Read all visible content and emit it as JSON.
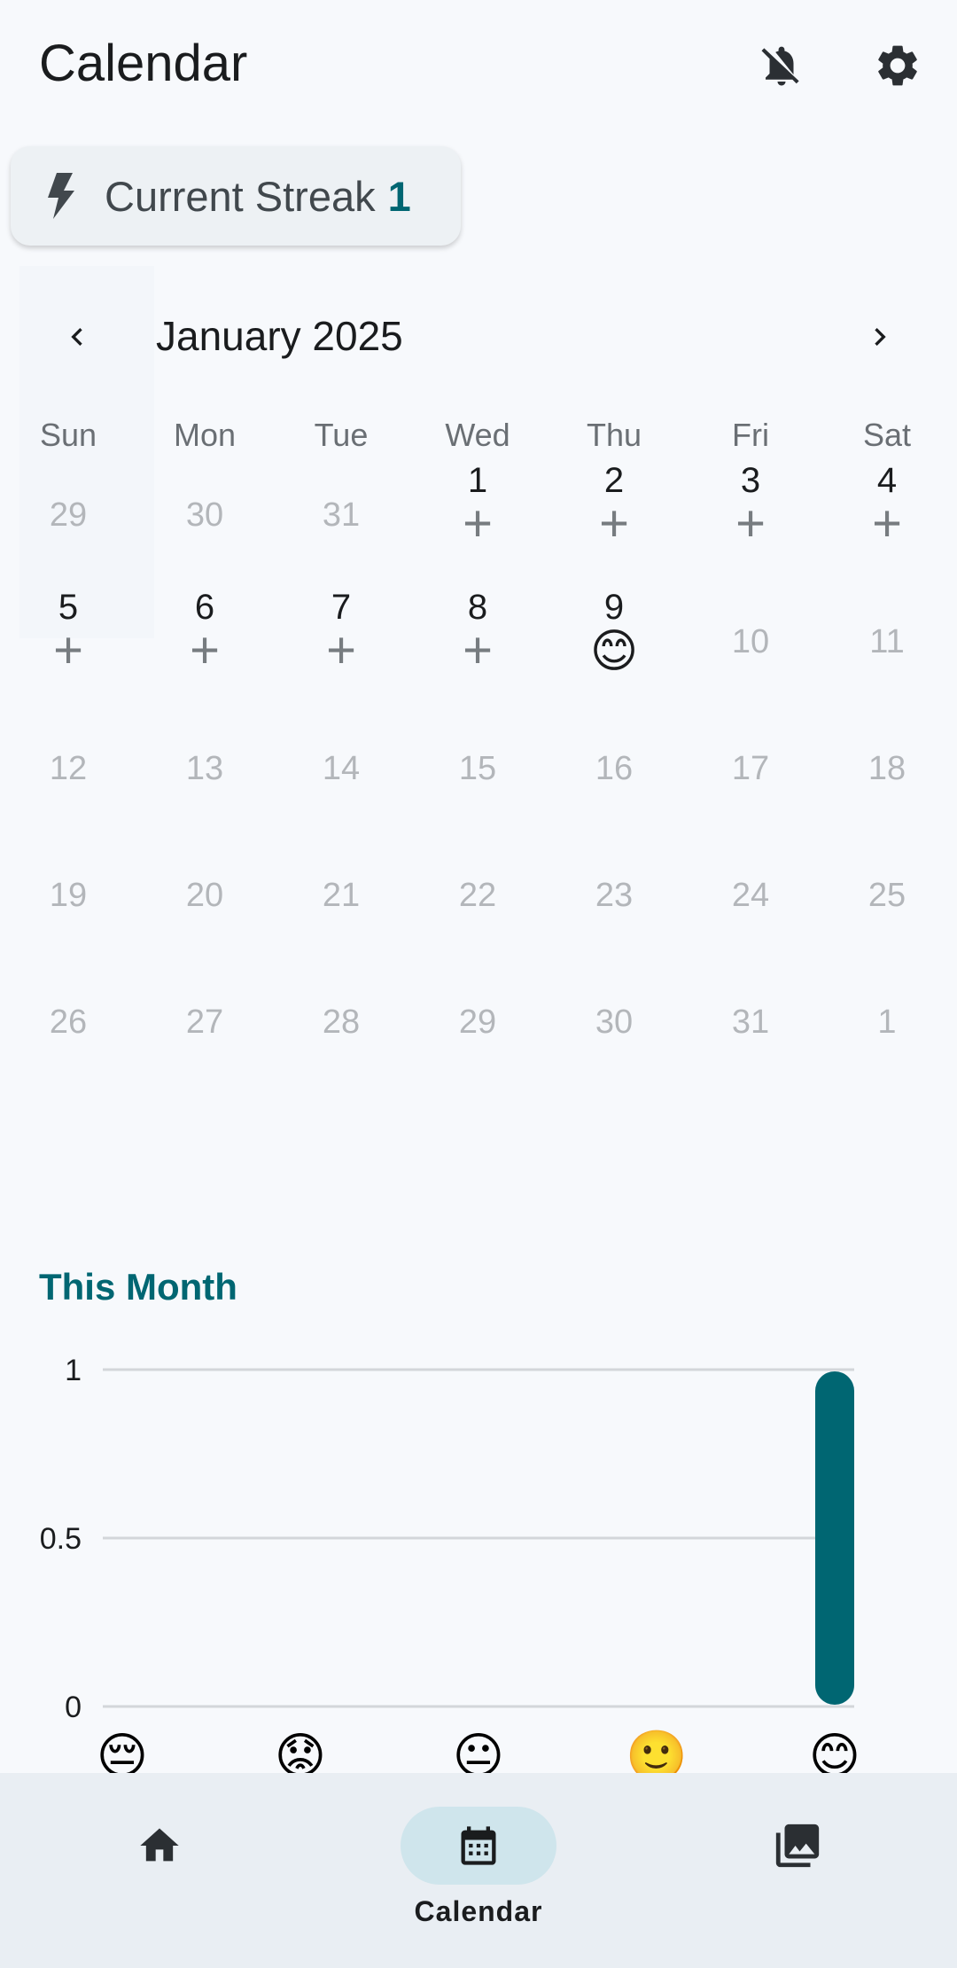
{
  "app_title": "Calendar",
  "icons": {
    "notifications_off": "bell-off-icon",
    "settings": "gear-icon",
    "streak": "bolt-icon",
    "prev_month": "chevron-left-icon",
    "next_month": "chevron-right-icon"
  },
  "streak": {
    "label": "Current Streak",
    "count": "1"
  },
  "calendar": {
    "month_label": "January 2025",
    "weekdays": [
      "Sun",
      "Mon",
      "Tue",
      "Wed",
      "Thu",
      "Fri",
      "Sat"
    ],
    "weeks": [
      [
        {
          "day": "29",
          "state": "muted"
        },
        {
          "day": "30",
          "state": "muted"
        },
        {
          "day": "31",
          "state": "muted"
        },
        {
          "day": "1",
          "state": "add"
        },
        {
          "day": "2",
          "state": "add"
        },
        {
          "day": "3",
          "state": "add"
        },
        {
          "day": "4",
          "state": "add"
        }
      ],
      [
        {
          "day": "5",
          "state": "add"
        },
        {
          "day": "6",
          "state": "add"
        },
        {
          "day": "7",
          "state": "add"
        },
        {
          "day": "8",
          "state": "add"
        },
        {
          "day": "9",
          "state": "mood",
          "mood": "😊"
        },
        {
          "day": "10",
          "state": "muted"
        },
        {
          "day": "11",
          "state": "muted"
        }
      ],
      [
        {
          "day": "12",
          "state": "muted"
        },
        {
          "day": "13",
          "state": "muted"
        },
        {
          "day": "14",
          "state": "muted"
        },
        {
          "day": "15",
          "state": "muted"
        },
        {
          "day": "16",
          "state": "muted"
        },
        {
          "day": "17",
          "state": "muted"
        },
        {
          "day": "18",
          "state": "muted"
        }
      ],
      [
        {
          "day": "19",
          "state": "muted"
        },
        {
          "day": "20",
          "state": "muted"
        },
        {
          "day": "21",
          "state": "muted"
        },
        {
          "day": "22",
          "state": "muted"
        },
        {
          "day": "23",
          "state": "muted"
        },
        {
          "day": "24",
          "state": "muted"
        },
        {
          "day": "25",
          "state": "muted"
        }
      ],
      [
        {
          "day": "26",
          "state": "muted"
        },
        {
          "day": "27",
          "state": "muted"
        },
        {
          "day": "28",
          "state": "muted"
        },
        {
          "day": "29",
          "state": "muted"
        },
        {
          "day": "30",
          "state": "muted"
        },
        {
          "day": "31",
          "state": "muted"
        },
        {
          "day": "1",
          "state": "muted"
        }
      ]
    ],
    "add_symbol": "+"
  },
  "section_title": "This Month",
  "chart_data": {
    "type": "bar",
    "categories": [
      "😔",
      "😟",
      "😐",
      "🙂",
      "😊"
    ],
    "values": [
      0,
      0,
      0,
      0,
      1
    ],
    "ylim": [
      0,
      1
    ],
    "yticks": [
      "0",
      "0.5",
      "1"
    ],
    "grid": true,
    "bar_color": "#006672"
  },
  "bottom_nav": {
    "items": [
      {
        "label": "",
        "icon": "home-icon",
        "active": false
      },
      {
        "label": "Calendar",
        "icon": "calendar-icon",
        "active": true
      },
      {
        "label": "",
        "icon": "photo-library-icon",
        "active": false
      }
    ]
  },
  "colors": {
    "accent": "#006672",
    "background": "#f7f9fc"
  }
}
